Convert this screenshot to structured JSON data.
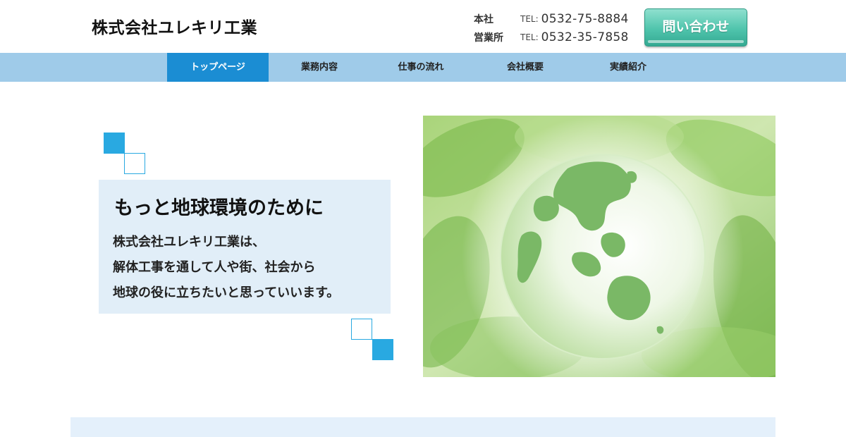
{
  "header": {
    "company_name": "株式会社ユレキリ工業",
    "contacts": [
      {
        "office": "本社",
        "tel_prefix": "TEL:",
        "tel": "0532-75-8884"
      },
      {
        "office": "営業所",
        "tel_prefix": "TEL:",
        "tel": "0532-35-7858"
      }
    ],
    "cta_label": "問い合わせ"
  },
  "nav": {
    "items": [
      {
        "label": "トップページ",
        "active": true
      },
      {
        "label": "業務内容",
        "active": false
      },
      {
        "label": "仕事の流れ",
        "active": false
      },
      {
        "label": "会社概要",
        "active": false
      },
      {
        "label": "実績紹介",
        "active": false
      }
    ]
  },
  "hero": {
    "title": "もっと地球環境のために",
    "lines": [
      "株式会社ユレキリ工業は、",
      "解体工事を通して人や街、社会から",
      "地球の役に立ちたいと思っていいます。"
    ],
    "image_icon": "globe-leaves-image"
  },
  "colors": {
    "nav_bg": "#9fcbe9",
    "nav_active": "#1b8dd3",
    "cta_green": "#4fc4ac",
    "accent_blue": "#29a9e1",
    "hero_box_bg": "#e1eef8"
  }
}
